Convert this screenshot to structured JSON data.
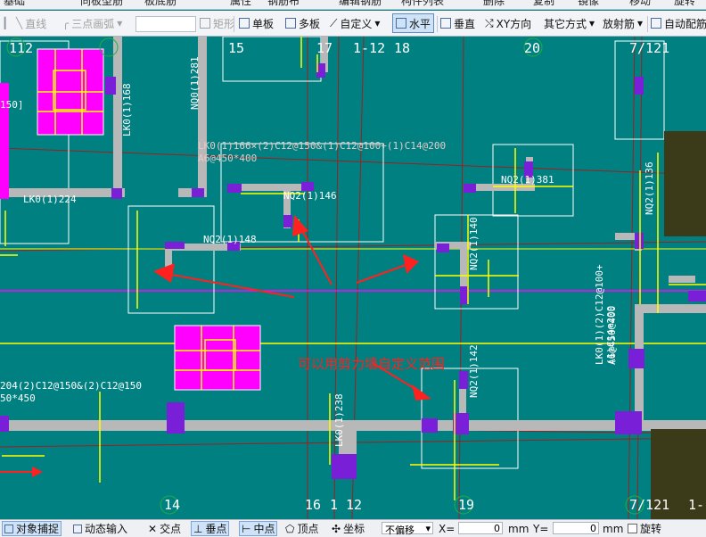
{
  "top_strip": {
    "left_text": "基础",
    "mid_text1": "同板型筋",
    "mid_text2": "板底筋",
    "items": [
      "属性",
      "钢筋布",
      "编辑钢筋",
      "构件列表",
      "删除",
      "复制",
      "镜像",
      "移动",
      "旋转"
    ]
  },
  "toolbar": {
    "straight_line": "直线",
    "three_point_arc": "三点画弧",
    "rectangle": "矩形",
    "single_slab": "单板",
    "multi_slab": "多板",
    "custom": "自定义",
    "horizontal": "水平",
    "vertical": "垂直",
    "xy_direction": "XY方向",
    "other_methods": "其它方式",
    "radial_bar": "放射筋",
    "auto_config": "自动配筋"
  },
  "grid_labels_top": [
    "112",
    "15",
    "17",
    "1-12",
    "18",
    "20",
    "7/121"
  ],
  "grid_labels_bottom": [
    "14",
    "16",
    "1",
    "12",
    "19",
    "7/121",
    "1-"
  ],
  "rebar_labels": {
    "lk_slab": "LK0(1)166×(2)C12@150&(1)C12@100+(1)C14@200",
    "lk_slab_dim": "A6@450*400",
    "nq2_11146": "NQ2(1)146",
    "nq2_11381": "NQ2(1)381",
    "nq2_11148": "NQ2(1)148",
    "nq2_11140": "NQ2(1)140",
    "nq2_11142": "NQ2(1)142",
    "lk0_11224": "LK0(1)224",
    "lk0_11168": "LK0(1)168",
    "lk0_11238": "LK0(1)238",
    "nq0_11281": "NQ0(1)281",
    "nq2_11136": "NQ2(1)136",
    "left_150": "150]",
    "lk_left_bottom": "204(2)C12@150&(2)C12@150",
    "lk_left_bottom_dim": "50*450",
    "right_vertical": "LK0(1)(2)C12@100+(1)C14@200",
    "right_vertical_dim": "A6@450*400"
  },
  "annotation": "可以用剪力墙自定义范围",
  "statusbar": {
    "object_snap": "对象捕捉",
    "dynamic_input": "动态输入",
    "intersection": "交点",
    "perpendicular": "垂点",
    "midpoint": "中点",
    "vertex": "顶点",
    "coordinate": "坐标",
    "offset_mode": "不偏移",
    "x_label": "X=",
    "x_value": "0",
    "x_unit": "mm",
    "y_label": "Y=",
    "y_value": "0",
    "y_unit": "mm",
    "rotate": "旋转"
  },
  "colors": {
    "canvas": "#008080",
    "wall": "#b8b8b8",
    "column": "#7a1fd8",
    "slab_fill": "#ff00ff",
    "yellow": "#ffff00",
    "white": "#ffffff",
    "red": "#ff2020",
    "dark": "#3b3b1a"
  }
}
